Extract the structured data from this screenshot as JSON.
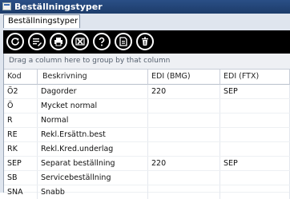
{
  "window": {
    "title": "Beställningstyper"
  },
  "tab": {
    "label": "Beställningstyper"
  },
  "toolbar": {
    "buttons": [
      {
        "icon": "refresh-icon"
      },
      {
        "icon": "list-edit-icon"
      },
      {
        "icon": "print-icon"
      },
      {
        "icon": "excel-export-icon"
      },
      {
        "icon": "help-icon"
      },
      {
        "icon": "document-icon"
      },
      {
        "icon": "delete-icon"
      }
    ]
  },
  "grid": {
    "group_hint": "Drag a column here to group by that column",
    "columns": [
      "Kod",
      "Beskrivning",
      "EDI (BMG)",
      "EDI (FTX)"
    ],
    "rows": [
      [
        "Ö2",
        "Dagorder",
        "220",
        "SEP"
      ],
      [
        "Ö",
        "Mycket normal",
        "",
        ""
      ],
      [
        "R",
        "Normal",
        "",
        ""
      ],
      [
        "RE",
        "Rekl.Ersättn.best",
        "",
        ""
      ],
      [
        "RK",
        "Rekl.Kred.underlag",
        "",
        ""
      ],
      [
        "SEP",
        "Separat beställning",
        "220",
        "SEP"
      ],
      [
        "SB",
        "Servicebeställning",
        "",
        ""
      ],
      [
        "SNA",
        "Snabb",
        "",
        ""
      ]
    ]
  }
}
